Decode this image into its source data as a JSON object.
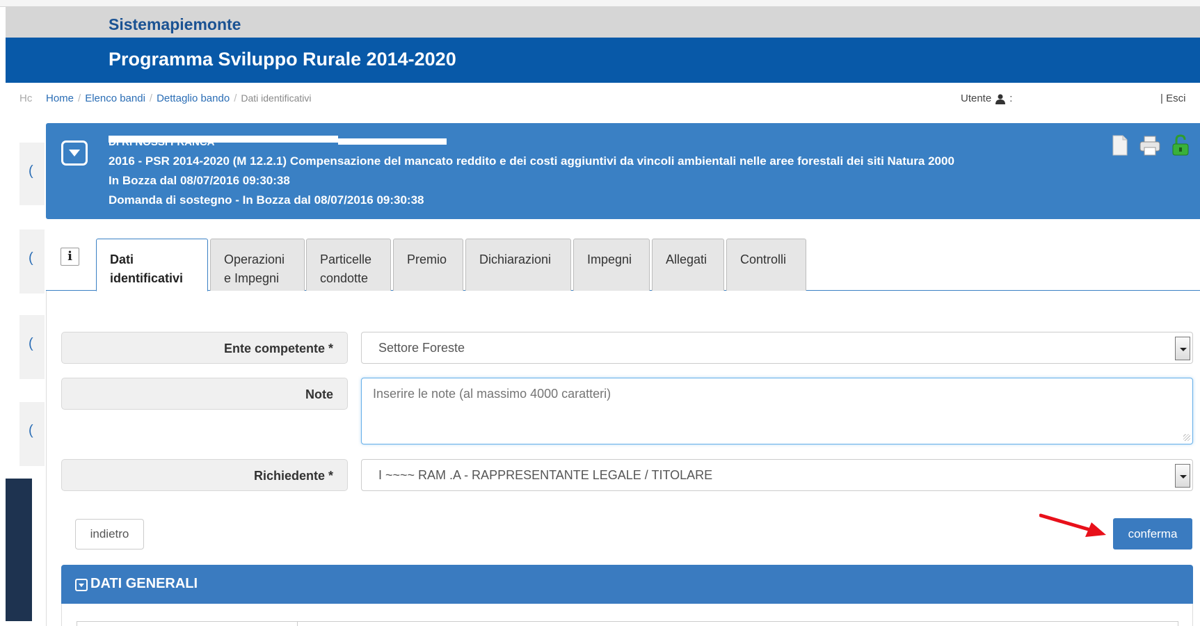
{
  "header": {
    "site_name": "Sistemapiemonte",
    "program_title": "Programma Sviluppo Rurale 2014-2020"
  },
  "breadcrumb": {
    "cut_text": "Hc",
    "items": [
      "Home",
      "Elenco bandi",
      "Dettaglio bando"
    ],
    "active": "Dati identificativi",
    "separator": "/"
  },
  "user": {
    "label": "Utente",
    "logout_label": "| Esci"
  },
  "panel": {
    "applicant": "DI RI NOSSI FRANCA",
    "line1": "2016 - PSR 2014-2020 (M 12.2.1) Compensazione del mancato reddito e dei costi aggiuntivi da vincoli ambientali nelle aree forestali dei siti Natura 2000",
    "line2": "In Bozza dal 08/07/2016 09:30:38",
    "line3": "Domanda di sostegno - In Bozza dal 08/07/2016 09:30:38"
  },
  "tabs": [
    {
      "line1": "Dati",
      "line2": "identificativi"
    },
    {
      "line1": "Operazioni",
      "line2": "e Impegni"
    },
    {
      "line1": "Particelle",
      "line2": "condotte"
    },
    {
      "line1": "Premio",
      "line2": ""
    },
    {
      "line1": "Dichiarazioni",
      "line2": ""
    },
    {
      "line1": "Impegni",
      "line2": ""
    },
    {
      "line1": "Allegati",
      "line2": ""
    },
    {
      "line1": "Controlli",
      "line2": ""
    }
  ],
  "form": {
    "ente_label": "Ente competente *",
    "ente_value": "Settore Foreste",
    "note_label": "Note",
    "note_placeholder": "Inserire le note (al massimo 4000 caratteri)",
    "richiedente_label": "Richiedente *",
    "richiedente_value": "I          ~~~~ RAM .A - RAPPRESENTANTE LEGALE / TITOLARE"
  },
  "buttons": {
    "back": "indietro",
    "confirm": "conferma"
  },
  "section": {
    "title": "DATI GENERALI"
  },
  "colors": {
    "brand_blue": "#0859a8",
    "panel_blue": "#3a80c4",
    "arrow_red": "#e8101a"
  },
  "icons": {
    "panel": [
      "document-icon",
      "print-icon",
      "unlock-icon"
    ],
    "user": "user-icon",
    "info": "info-icon",
    "toggle": "collapse-toggle-icon"
  }
}
